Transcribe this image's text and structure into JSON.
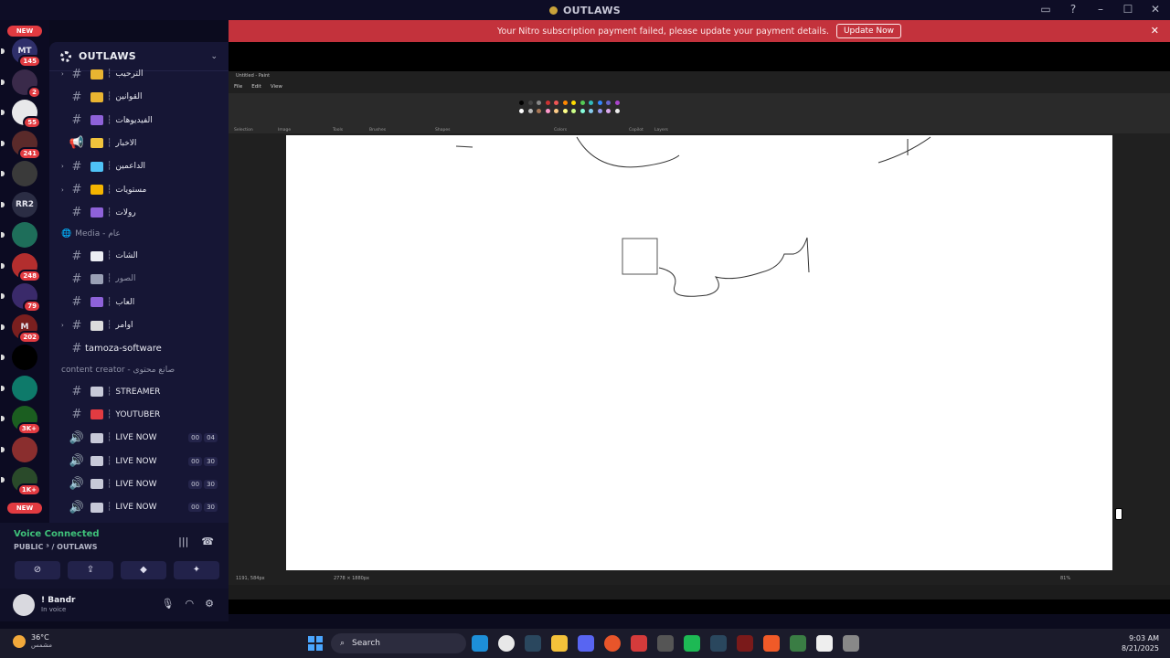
{
  "window": {
    "title": "OUTLAWS"
  },
  "nitro_banner": {
    "message": "Your Nitro subscription payment failed, please update your payment details.",
    "button": "Update Now"
  },
  "rail": {
    "new_top": "NEW",
    "new_bottom": "NEW",
    "servers": [
      {
        "label": "MT",
        "badge": "145"
      },
      {
        "label": "",
        "badge": "2"
      },
      {
        "label": "",
        "badge": "55"
      },
      {
        "label": "",
        "badge": "241"
      },
      {
        "label": "",
        "badge": ""
      },
      {
        "label": "RR2",
        "badge": ""
      },
      {
        "label": "",
        "badge": ""
      },
      {
        "label": "",
        "badge": "248"
      },
      {
        "label": "",
        "badge": "79"
      },
      {
        "label": "M",
        "badge": "202"
      },
      {
        "label": "",
        "badge": ""
      },
      {
        "label": "",
        "badge": ""
      },
      {
        "label": "",
        "badge": "3K+"
      },
      {
        "label": "",
        "badge": ""
      },
      {
        "label": "",
        "badge": "1K+"
      }
    ]
  },
  "sidebar": {
    "server_name": "OUTLAWS",
    "channels": [
      {
        "label": "الترحيب",
        "type": "text",
        "color": "#e9b431"
      },
      {
        "label": "القوانين",
        "type": "text",
        "color": "#e9b431"
      },
      {
        "label": "الفيديوهات",
        "type": "text",
        "color": "#8e62d9"
      },
      {
        "label": "الاخبار",
        "type": "announce",
        "color": "#f0c33c"
      },
      {
        "label": "الداعمين",
        "type": "text",
        "color": "#4fc3f7"
      },
      {
        "label": "مستويات",
        "type": "text",
        "color": "#f4b400"
      },
      {
        "label": "رولات",
        "type": "text",
        "color": "#8e62d9"
      }
    ],
    "category_media": "Media - عام",
    "media_channels": [
      {
        "label": "الشات",
        "type": "text",
        "color": "#eceef4"
      },
      {
        "label": "الصور",
        "type": "text",
        "color": "#9aa0b5"
      },
      {
        "label": "العاب",
        "type": "text",
        "color": "#8e62d9"
      },
      {
        "label": "اوامر",
        "type": "text",
        "color": "#dcdcdc"
      },
      {
        "label": "tamoza-software",
        "type": "text",
        "color": ""
      }
    ],
    "category_creator": "content creator - صانع محتوى",
    "creator_channels": [
      {
        "label": "STREAMER",
        "type": "text",
        "color": "#c7c9d8",
        "count_a": "",
        "count_b": ""
      },
      {
        "label": "YOUTUBER",
        "type": "text",
        "color": "#e23b41",
        "count_a": "",
        "count_b": ""
      },
      {
        "label": "LIVE NOW",
        "type": "voice",
        "color": "#c7c9d8",
        "count_a": "00",
        "count_b": "04"
      },
      {
        "label": "LIVE NOW",
        "type": "voice",
        "color": "#c7c9d8",
        "count_a": "00",
        "count_b": "30"
      },
      {
        "label": "LIVE NOW",
        "type": "voice",
        "color": "#c7c9d8",
        "count_a": "00",
        "count_b": "30"
      },
      {
        "label": "LIVE NOW",
        "type": "voice",
        "color": "#c7c9d8",
        "count_a": "00",
        "count_b": "30"
      }
    ]
  },
  "voice": {
    "status": "Voice Connected",
    "channel": "PUBLIC ³ / OUTLAWS"
  },
  "user": {
    "name": "! Bandr",
    "status": "In voice"
  },
  "paint": {
    "title": "Untitled - Paint",
    "menu": [
      "File",
      "Edit",
      "View"
    ],
    "groups": [
      "Selection",
      "Image",
      "Tools",
      "Brushes",
      "Shapes",
      "Colors",
      "Copilot",
      "Layers"
    ],
    "status_left": "1191, 584px",
    "status_size": "2778 × 1880px",
    "zoom": "81%"
  },
  "taskbar": {
    "temperature": "36°C",
    "condition": "مشمس",
    "search": "Search",
    "time": "9:03 AM",
    "date": "8/21/2025"
  }
}
